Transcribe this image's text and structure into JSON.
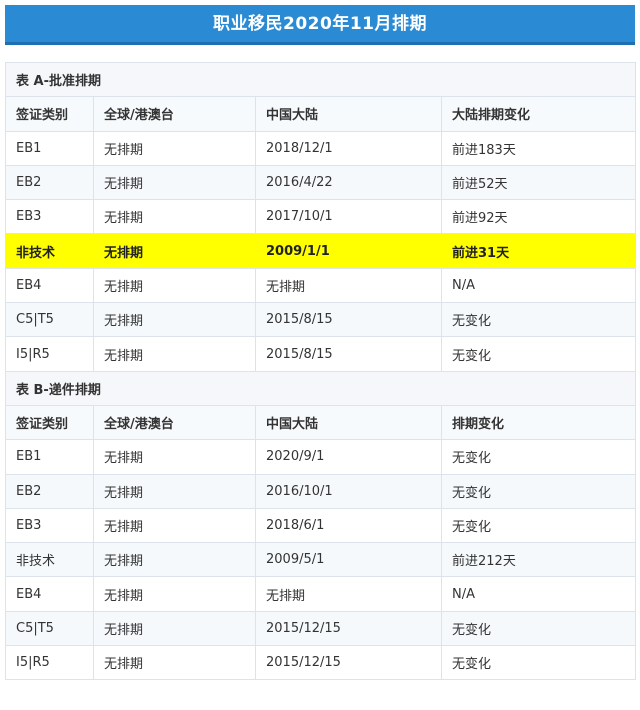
{
  "title": "职业移民2020年11月排期",
  "table_a": {
    "section_title": "表 A-批准排期",
    "headers": [
      "签证类别",
      "全球/港澳台",
      "中国大陆",
      "大陆排期变化"
    ],
    "rows": [
      [
        "EB1",
        "无排期",
        "2018/12/1",
        "前进183天"
      ],
      [
        "EB2",
        "无排期",
        "2016/4/22",
        "前进52天"
      ],
      [
        "EB3",
        "无排期",
        "2017/10/1",
        "前进92天"
      ],
      [
        "非技术",
        "无排期",
        "2009/1/1",
        "前进31天"
      ],
      [
        "EB4",
        "无排期",
        "无排期",
        "N/A"
      ],
      [
        "C5|T5",
        "无排期",
        "2015/8/15",
        "无变化"
      ],
      [
        "I5|R5",
        "无排期",
        "2015/8/15",
        "无变化"
      ]
    ],
    "highlight_row": 3,
    "highlight_color": "#ffff00"
  },
  "table_b": {
    "section_title": "表 B-递件排期",
    "headers": [
      "签证类别",
      "全球/港澳台",
      "中国大陆",
      "排期变化"
    ],
    "rows": [
      [
        "EB1",
        "无排期",
        "2020/9/1",
        "无变化"
      ],
      [
        "EB2",
        "无排期",
        "2016/10/1",
        "无变化"
      ],
      [
        "EB3",
        "无排期",
        "2018/6/1",
        "无变化"
      ],
      [
        "非技术",
        "无排期",
        "2009/5/1",
        "前进212天"
      ],
      [
        "EB4",
        "无排期",
        "无排期",
        "N/A"
      ],
      [
        "C5|T5",
        "无排期",
        "2015/12/15",
        "无变化"
      ],
      [
        "I5|R5",
        "无排期",
        "2015/12/15",
        "无变化"
      ]
    ]
  },
  "colors": {
    "banner": "#2a8ad4",
    "banner_text": "#ffffff",
    "highlight": "#ffff00",
    "border": "#dde3ea"
  }
}
